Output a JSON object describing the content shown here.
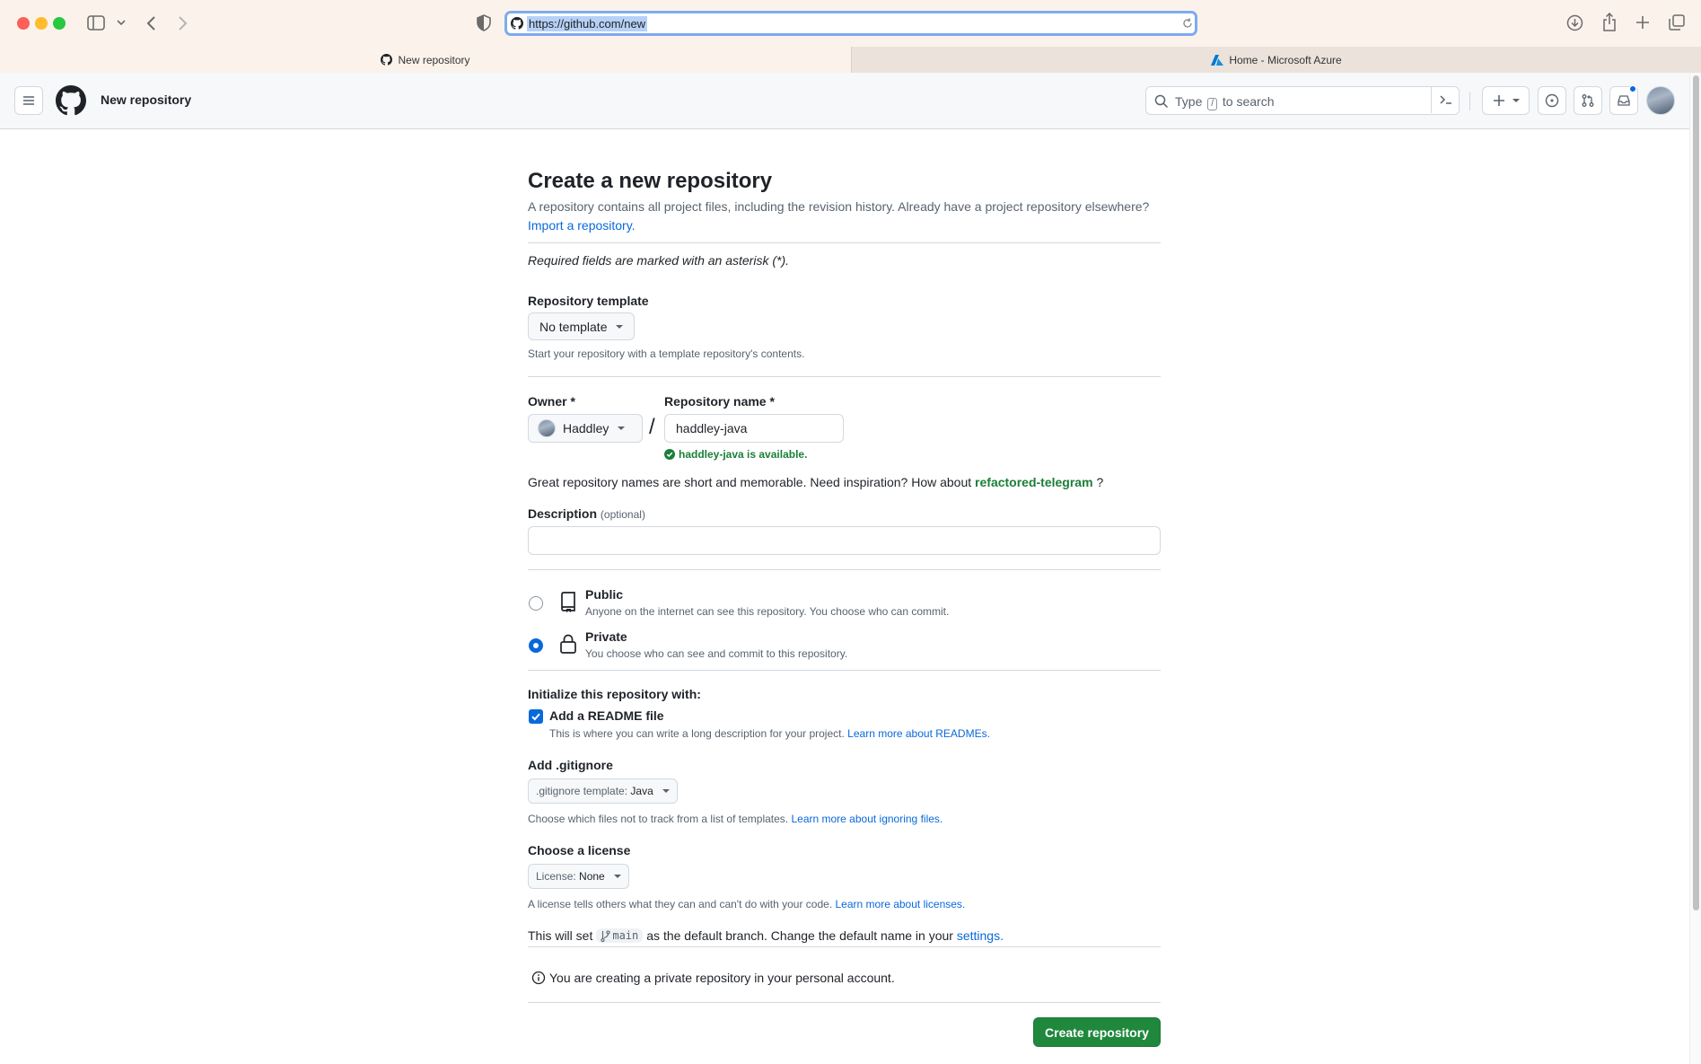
{
  "browser": {
    "url": "https://github.com/new",
    "tabs": [
      {
        "label": "New repository"
      },
      {
        "label": "Home - Microsoft Azure"
      }
    ]
  },
  "header": {
    "context_title": "New repository",
    "search_prefix": "Type",
    "search_key": "/",
    "search_suffix": "to search"
  },
  "form": {
    "title": "Create a new repository",
    "lead": "A repository contains all project files, including the revision history. Already have a project repository elsewhere?",
    "import_link": "Import a repository.",
    "required_note": "Required fields are marked with an asterisk (*).",
    "template": {
      "label": "Repository template",
      "value": "No template",
      "hint": "Start your repository with a template repository's contents."
    },
    "owner": {
      "label": "Owner *",
      "value": "Haddley"
    },
    "repo_name": {
      "label": "Repository name *",
      "value": "haddley-java",
      "availability": "haddley-java is available."
    },
    "slash": "/",
    "suggestion": {
      "prefix": "Great repository names are short and memorable. Need inspiration? How about",
      "name": "refactored-telegram",
      "suffix": "?"
    },
    "description": {
      "label": "Description",
      "optional": "(optional)",
      "value": ""
    },
    "visibility": {
      "public": {
        "title": "Public",
        "desc": "Anyone on the internet can see this repository. You choose who can commit.",
        "selected": false
      },
      "private": {
        "title": "Private",
        "desc": "You choose who can see and commit to this repository.",
        "selected": true
      }
    },
    "init": {
      "label": "Initialize this repository with:",
      "readme_label": "Add a README file",
      "readme_checked": true,
      "readme_hint": "This is where you can write a long description for your project.",
      "readme_link": "Learn more about READMEs."
    },
    "gitignore": {
      "label": "Add .gitignore",
      "prefix": ".gitignore template:",
      "value": "Java",
      "hint": "Choose which files not to track from a list of templates.",
      "link": "Learn more about ignoring files."
    },
    "license": {
      "label": "Choose a license",
      "prefix": "License:",
      "value": "None",
      "hint": "A license tells others what they can and can't do with your code.",
      "link": "Learn more about licenses."
    },
    "branch": {
      "prefix": "This will set",
      "name": "main",
      "middle": "as the default branch. Change the default name in your",
      "link": "settings."
    },
    "info": "You are creating a private repository in your personal account.",
    "submit": "Create repository"
  },
  "colors": {
    "primary_button": "#1f883d",
    "link": "#0969da",
    "success": "#1a7f37"
  }
}
